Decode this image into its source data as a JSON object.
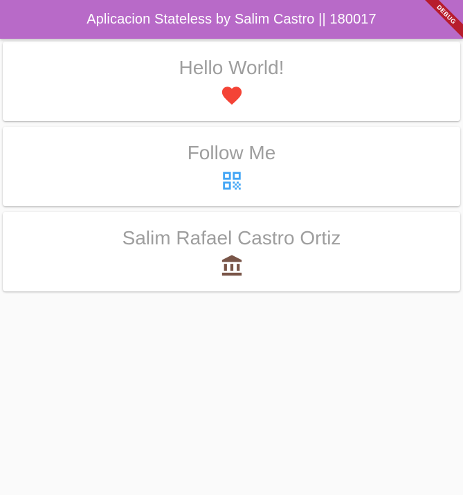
{
  "app_bar": {
    "title": "Aplicacion Stateless by Salim Castro || 180017",
    "color": "#b86ac8",
    "debug_banner": "DEBUG"
  },
  "cards": [
    {
      "title": "Hello World!",
      "icon": "heart-icon",
      "icon_color": "#f44336"
    },
    {
      "title": "Follow Me",
      "icon": "qr-code-icon",
      "icon_color": "#42a5f5"
    },
    {
      "title": "Salim Rafael Castro Ortiz",
      "icon": "bank-icon",
      "icon_color": "#795548"
    }
  ]
}
